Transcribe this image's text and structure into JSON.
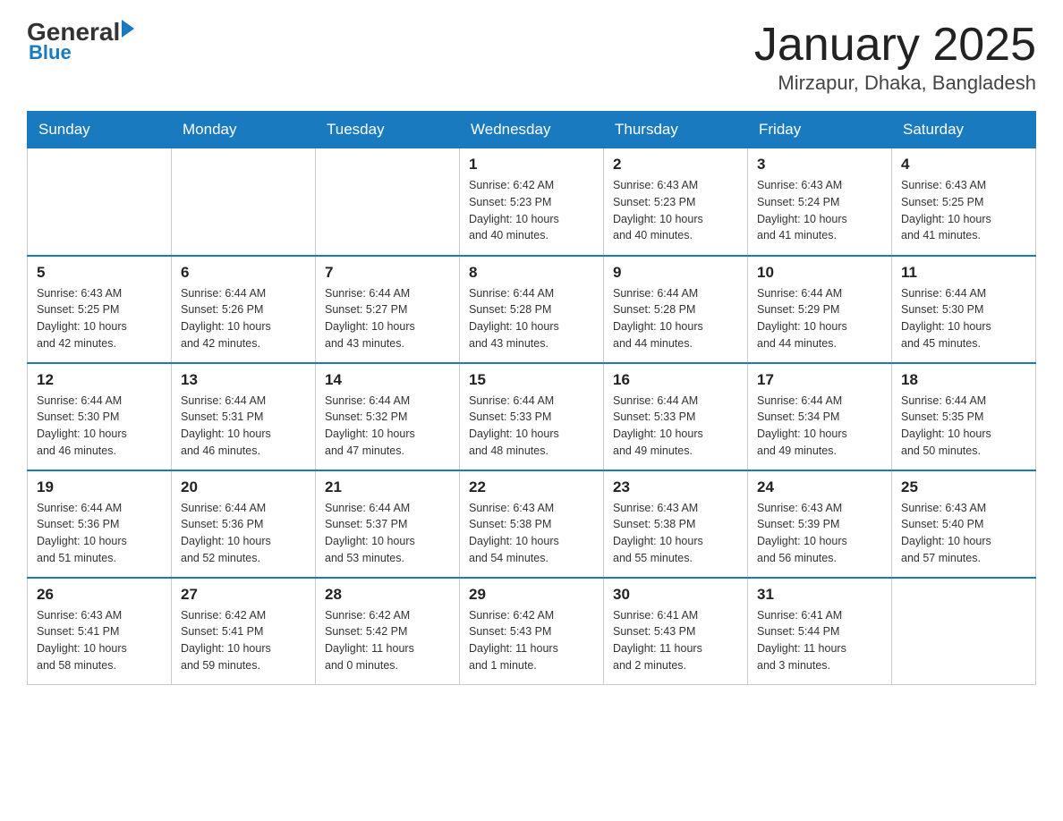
{
  "header": {
    "logo_general": "General",
    "logo_blue": "Blue",
    "month_title": "January 2025",
    "location": "Mirzapur, Dhaka, Bangladesh"
  },
  "weekdays": [
    "Sunday",
    "Monday",
    "Tuesday",
    "Wednesday",
    "Thursday",
    "Friday",
    "Saturday"
  ],
  "weeks": [
    [
      {
        "day": "",
        "info": ""
      },
      {
        "day": "",
        "info": ""
      },
      {
        "day": "",
        "info": ""
      },
      {
        "day": "1",
        "info": "Sunrise: 6:42 AM\nSunset: 5:23 PM\nDaylight: 10 hours\nand 40 minutes."
      },
      {
        "day": "2",
        "info": "Sunrise: 6:43 AM\nSunset: 5:23 PM\nDaylight: 10 hours\nand 40 minutes."
      },
      {
        "day": "3",
        "info": "Sunrise: 6:43 AM\nSunset: 5:24 PM\nDaylight: 10 hours\nand 41 minutes."
      },
      {
        "day": "4",
        "info": "Sunrise: 6:43 AM\nSunset: 5:25 PM\nDaylight: 10 hours\nand 41 minutes."
      }
    ],
    [
      {
        "day": "5",
        "info": "Sunrise: 6:43 AM\nSunset: 5:25 PM\nDaylight: 10 hours\nand 42 minutes."
      },
      {
        "day": "6",
        "info": "Sunrise: 6:44 AM\nSunset: 5:26 PM\nDaylight: 10 hours\nand 42 minutes."
      },
      {
        "day": "7",
        "info": "Sunrise: 6:44 AM\nSunset: 5:27 PM\nDaylight: 10 hours\nand 43 minutes."
      },
      {
        "day": "8",
        "info": "Sunrise: 6:44 AM\nSunset: 5:28 PM\nDaylight: 10 hours\nand 43 minutes."
      },
      {
        "day": "9",
        "info": "Sunrise: 6:44 AM\nSunset: 5:28 PM\nDaylight: 10 hours\nand 44 minutes."
      },
      {
        "day": "10",
        "info": "Sunrise: 6:44 AM\nSunset: 5:29 PM\nDaylight: 10 hours\nand 44 minutes."
      },
      {
        "day": "11",
        "info": "Sunrise: 6:44 AM\nSunset: 5:30 PM\nDaylight: 10 hours\nand 45 minutes."
      }
    ],
    [
      {
        "day": "12",
        "info": "Sunrise: 6:44 AM\nSunset: 5:30 PM\nDaylight: 10 hours\nand 46 minutes."
      },
      {
        "day": "13",
        "info": "Sunrise: 6:44 AM\nSunset: 5:31 PM\nDaylight: 10 hours\nand 46 minutes."
      },
      {
        "day": "14",
        "info": "Sunrise: 6:44 AM\nSunset: 5:32 PM\nDaylight: 10 hours\nand 47 minutes."
      },
      {
        "day": "15",
        "info": "Sunrise: 6:44 AM\nSunset: 5:33 PM\nDaylight: 10 hours\nand 48 minutes."
      },
      {
        "day": "16",
        "info": "Sunrise: 6:44 AM\nSunset: 5:33 PM\nDaylight: 10 hours\nand 49 minutes."
      },
      {
        "day": "17",
        "info": "Sunrise: 6:44 AM\nSunset: 5:34 PM\nDaylight: 10 hours\nand 49 minutes."
      },
      {
        "day": "18",
        "info": "Sunrise: 6:44 AM\nSunset: 5:35 PM\nDaylight: 10 hours\nand 50 minutes."
      }
    ],
    [
      {
        "day": "19",
        "info": "Sunrise: 6:44 AM\nSunset: 5:36 PM\nDaylight: 10 hours\nand 51 minutes."
      },
      {
        "day": "20",
        "info": "Sunrise: 6:44 AM\nSunset: 5:36 PM\nDaylight: 10 hours\nand 52 minutes."
      },
      {
        "day": "21",
        "info": "Sunrise: 6:44 AM\nSunset: 5:37 PM\nDaylight: 10 hours\nand 53 minutes."
      },
      {
        "day": "22",
        "info": "Sunrise: 6:43 AM\nSunset: 5:38 PM\nDaylight: 10 hours\nand 54 minutes."
      },
      {
        "day": "23",
        "info": "Sunrise: 6:43 AM\nSunset: 5:38 PM\nDaylight: 10 hours\nand 55 minutes."
      },
      {
        "day": "24",
        "info": "Sunrise: 6:43 AM\nSunset: 5:39 PM\nDaylight: 10 hours\nand 56 minutes."
      },
      {
        "day": "25",
        "info": "Sunrise: 6:43 AM\nSunset: 5:40 PM\nDaylight: 10 hours\nand 57 minutes."
      }
    ],
    [
      {
        "day": "26",
        "info": "Sunrise: 6:43 AM\nSunset: 5:41 PM\nDaylight: 10 hours\nand 58 minutes."
      },
      {
        "day": "27",
        "info": "Sunrise: 6:42 AM\nSunset: 5:41 PM\nDaylight: 10 hours\nand 59 minutes."
      },
      {
        "day": "28",
        "info": "Sunrise: 6:42 AM\nSunset: 5:42 PM\nDaylight: 11 hours\nand 0 minutes."
      },
      {
        "day": "29",
        "info": "Sunrise: 6:42 AM\nSunset: 5:43 PM\nDaylight: 11 hours\nand 1 minute."
      },
      {
        "day": "30",
        "info": "Sunrise: 6:41 AM\nSunset: 5:43 PM\nDaylight: 11 hours\nand 2 minutes."
      },
      {
        "day": "31",
        "info": "Sunrise: 6:41 AM\nSunset: 5:44 PM\nDaylight: 11 hours\nand 3 minutes."
      },
      {
        "day": "",
        "info": ""
      }
    ]
  ]
}
